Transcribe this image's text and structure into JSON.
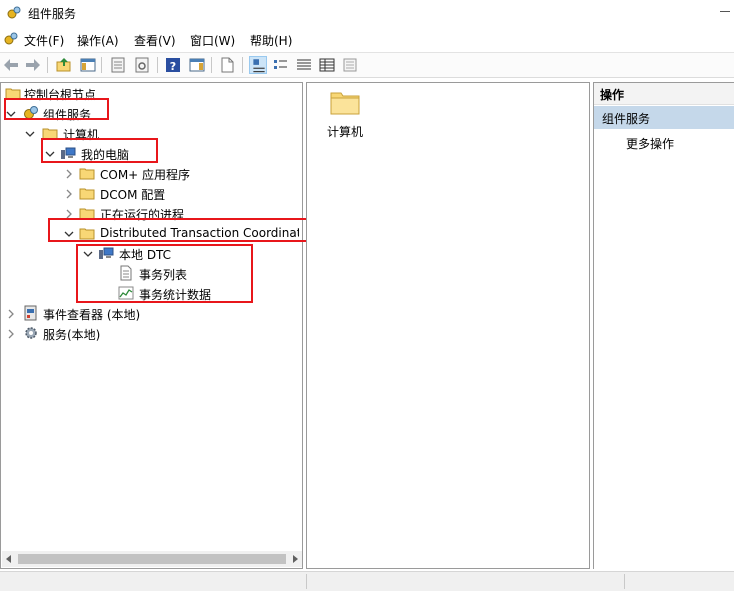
{
  "window": {
    "title": "组件服务"
  },
  "menu": {
    "items": [
      "文件(F)",
      "操作(A)",
      "查看(V)",
      "窗口(W)",
      "帮助(H)"
    ]
  },
  "toolbar": {
    "buttons": [
      "back-arrow-icon",
      "forward-arrow-icon",
      "up-folder-icon",
      "show-hide-tree-icon",
      "properties-icon",
      "refresh-icon",
      "help-icon",
      "show-hide-action-icon",
      "new-icon",
      "large-icons-view-icon",
      "small-icons-view-icon",
      "list-view-icon",
      "details-view-icon"
    ]
  },
  "tree": {
    "root": "控制台根节点",
    "component_services": "组件服务",
    "computers": "计算机",
    "my_computer": "我的电脑",
    "com_apps": "COM+ 应用程序",
    "dcom_config": "DCOM 配置",
    "running_processes": "正在运行的进程",
    "dtc": "Distributed Transaction Coordinator",
    "local_dtc": "本地 DTC",
    "transaction_list": "事务列表",
    "transaction_stats": "事务统计数据",
    "event_viewer": "事件查看器 (本地)",
    "services": "服务(本地)"
  },
  "center": {
    "item_label": "计算机"
  },
  "actions": {
    "header": "操作",
    "group": "组件服务",
    "more": "更多操作"
  },
  "colors": {
    "annotation_red": "#e8161b",
    "action_group_bg": "#c5d8ea",
    "folder_yellow": "#f8d775"
  }
}
